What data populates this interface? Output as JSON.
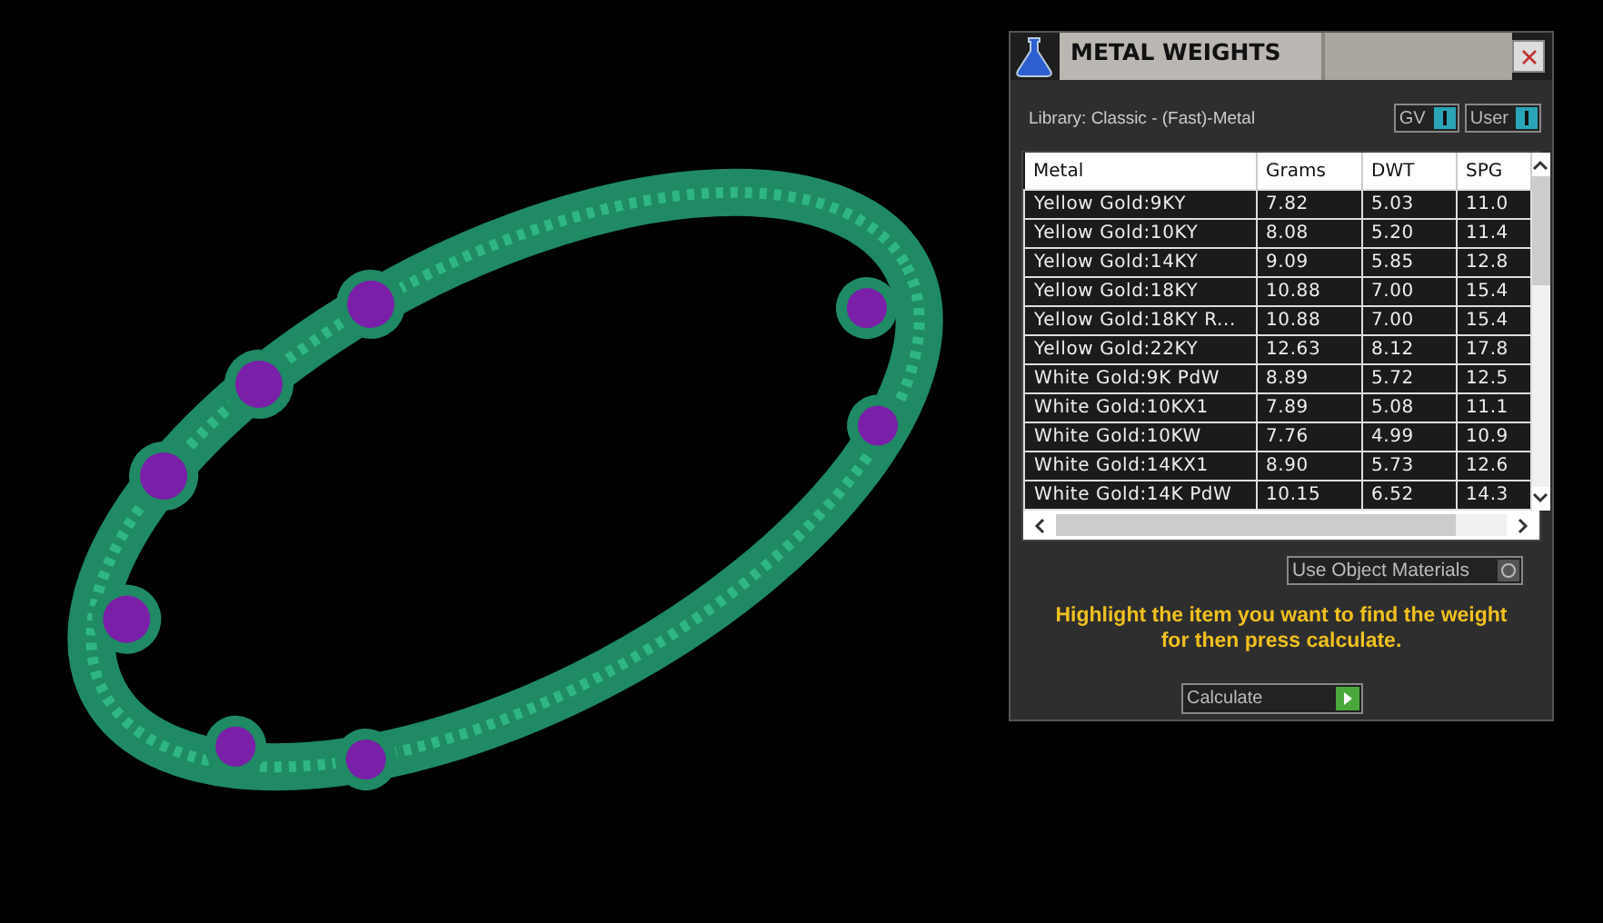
{
  "panel": {
    "title": "METAL WEIGHTS",
    "library": "Library: Classic - (Fast)-Metal",
    "toggles": [
      {
        "label": "GV",
        "on": true
      },
      {
        "label": "User",
        "on": true
      }
    ],
    "table": {
      "columns": [
        "Metal",
        "Grams",
        "DWT",
        "SPG"
      ],
      "rows": [
        [
          "Yellow Gold:9KY",
          "7.82",
          "5.03",
          "11.0"
        ],
        [
          "Yellow Gold:10KY",
          "8.08",
          "5.20",
          "11.4"
        ],
        [
          "Yellow Gold:14KY",
          "9.09",
          "5.85",
          "12.8"
        ],
        [
          "Yellow Gold:18KY",
          "10.88",
          "7.00",
          "15.4"
        ],
        [
          "Yellow Gold:18KY R...",
          "10.88",
          "7.00",
          "15.4"
        ],
        [
          "Yellow Gold:22KY",
          "12.63",
          "8.12",
          "17.8"
        ],
        [
          "White Gold:9K PdW",
          "8.89",
          "5.72",
          "12.5"
        ],
        [
          "White Gold:10KX1",
          "7.89",
          "5.08",
          "11.1"
        ],
        [
          "White Gold:10KW",
          "7.76",
          "4.99",
          "10.9"
        ],
        [
          "White Gold:14KX1",
          "8.90",
          "5.73",
          "12.6"
        ],
        [
          "White Gold:14K PdW",
          "10.15",
          "6.52",
          "14.3"
        ]
      ]
    },
    "use_object_materials": {
      "label": "Use Object Materials",
      "on": false
    },
    "hint": "Highlight the item you want to find the weight for then press calculate.",
    "calculate_button": "Calculate"
  }
}
